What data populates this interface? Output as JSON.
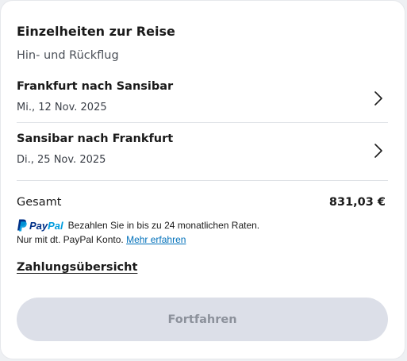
{
  "details": {
    "title": "Einzelheiten zur Reise",
    "trip_type": "Hin- und Rückflug"
  },
  "legs": [
    {
      "route": "Frankfurt nach Sansibar",
      "date": "Mi., 12 Nov. 2025",
      "icon": "chevron-right-icon"
    },
    {
      "route": "Sansibar nach Frankfurt",
      "date": "Di., 25 Nov. 2025",
      "icon": "chevron-right-icon"
    }
  ],
  "total": {
    "label": "Gesamt",
    "value": "831,03 €"
  },
  "paypal": {
    "brand_part1": "Pay",
    "brand_part2": "Pal",
    "installment_text": "Bezahlen Sie in bis zu 24 monatlichen Raten.",
    "note_text": "Nur mit dt. PayPal Konto.",
    "link_text": "Mehr erfahren",
    "colors": {
      "dark_blue": "#003087",
      "light_blue": "#009cde",
      "link": "#0070ba"
    }
  },
  "payment_summary_link": "Zahlungsübersicht",
  "continue_button": {
    "label": "Fortfahren",
    "disabled": true,
    "background": "#dcdfe8",
    "text_color": "#8c919b"
  }
}
